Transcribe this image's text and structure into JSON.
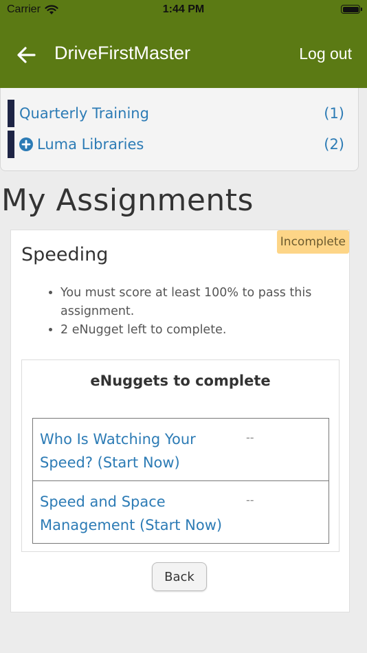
{
  "status_bar": {
    "carrier": "Carrier",
    "time": "1:44 PM",
    "wifi_icon": "wifi-icon",
    "battery_icon": "battery-icon"
  },
  "app_bar": {
    "back_icon": "arrow-left-icon",
    "title": "DriveFirstMaster",
    "logout": "Log out",
    "background_color": "#5b7a14"
  },
  "libraries": [
    {
      "label": "Quarterly Training",
      "count": "(1)",
      "icon": ""
    },
    {
      "label": "Luma Libraries",
      "count": "(2)",
      "icon": "plus-circle-icon"
    }
  ],
  "page_heading": "My Assignments",
  "assignment": {
    "title": "Speeding",
    "status": "Incomplete",
    "status_color": "#fdd587",
    "details": [
      "You must score at least 100% to pass this assignment.",
      "2 eNugget left to complete."
    ],
    "enuggets_title": "eNuggets to complete",
    "enuggets": [
      {
        "title": "Who Is Watching Your Speed? (Start Now)",
        "score": "--"
      },
      {
        "title": "Speed and Space Management (Start Now)",
        "score": "--"
      }
    ],
    "back_label": "Back"
  },
  "colors": {
    "link": "#2c7bb5",
    "library_bar": "#1e2445"
  }
}
